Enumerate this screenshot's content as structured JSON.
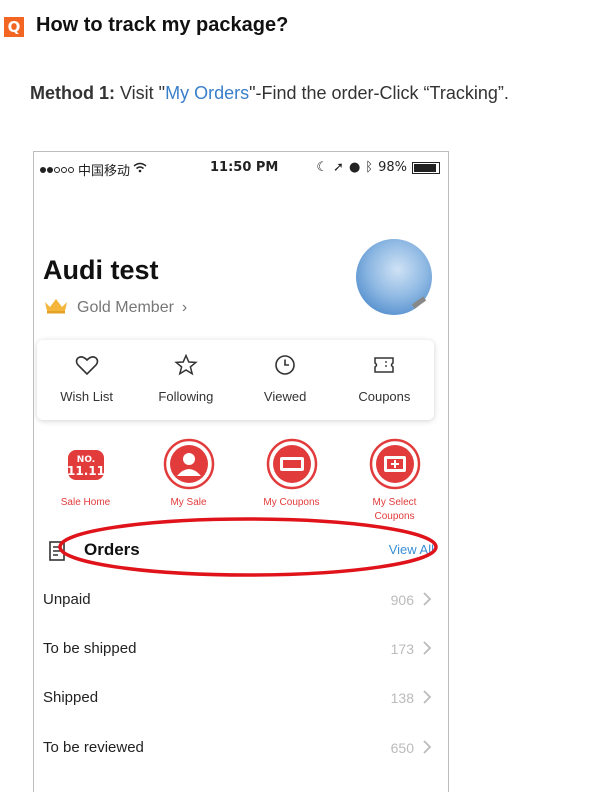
{
  "question": {
    "badge": "Q",
    "title": "How to track my package?"
  },
  "method": {
    "label": "Method 1:",
    "pre": " Visit \"",
    "link": "My Orders",
    "post": "\"-Find the order-Click “Tracking”."
  },
  "phone": {
    "status": {
      "carrier": "中国移动",
      "time": "11:50 PM",
      "battery": "98%"
    },
    "profile": {
      "name": "Audi test",
      "member_level": "Gold Member",
      "member_chevron": "›"
    },
    "quick_links": [
      {
        "label": "Wish List",
        "icon": "heart-icon"
      },
      {
        "label": "Following",
        "icon": "star-icon"
      },
      {
        "label": "Viewed",
        "icon": "clock-icon"
      },
      {
        "label": "Coupons",
        "icon": "coupon-icon"
      }
    ],
    "tiles": [
      {
        "label": "Sale Home",
        "icon": "sale-11-11-icon"
      },
      {
        "label": "My Sale",
        "icon": "person-icon"
      },
      {
        "label": "My Coupons",
        "icon": "ticket-icon"
      },
      {
        "label_line1": "My Select",
        "label_line2": "Coupons",
        "icon": "select-coupon-icon"
      }
    ],
    "orders": {
      "title": "Orders",
      "view_all": "View All",
      "rows": [
        {
          "label": "Unpaid",
          "count": "906"
        },
        {
          "label": "To be shipped",
          "count": "173"
        },
        {
          "label": "Shipped",
          "count": "138"
        },
        {
          "label": "To be reviewed",
          "count": "650"
        }
      ]
    },
    "colors": {
      "accent_red": "#e23b3b",
      "link_blue": "#3a8fd6",
      "badge_orange": "#f26522",
      "annotation_red": "#e0131a"
    }
  }
}
